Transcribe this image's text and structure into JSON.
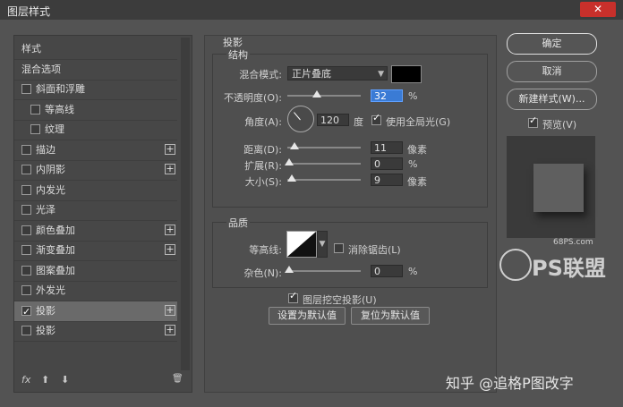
{
  "window": {
    "title": "图层样式",
    "close_label": "✕"
  },
  "left_panel": {
    "items": [
      {
        "label": "样式",
        "checkbox": false,
        "checked": false,
        "plus": false,
        "indent": 0
      },
      {
        "label": "混合选项",
        "checkbox": false,
        "checked": false,
        "plus": false,
        "indent": 0
      },
      {
        "label": "斜面和浮雕",
        "checkbox": true,
        "checked": false,
        "plus": false,
        "indent": 0
      },
      {
        "label": "等高线",
        "checkbox": true,
        "checked": false,
        "plus": false,
        "indent": 1
      },
      {
        "label": "纹理",
        "checkbox": true,
        "checked": false,
        "plus": false,
        "indent": 1
      },
      {
        "label": "描边",
        "checkbox": true,
        "checked": false,
        "plus": true,
        "indent": 0
      },
      {
        "label": "内阴影",
        "checkbox": true,
        "checked": false,
        "plus": true,
        "indent": 0
      },
      {
        "label": "内发光",
        "checkbox": true,
        "checked": false,
        "plus": false,
        "indent": 0
      },
      {
        "label": "光泽",
        "checkbox": true,
        "checked": false,
        "plus": false,
        "indent": 0
      },
      {
        "label": "颜色叠加",
        "checkbox": true,
        "checked": false,
        "plus": true,
        "indent": 0
      },
      {
        "label": "渐变叠加",
        "checkbox": true,
        "checked": false,
        "plus": true,
        "indent": 0
      },
      {
        "label": "图案叠加",
        "checkbox": true,
        "checked": false,
        "plus": false,
        "indent": 0
      },
      {
        "label": "外发光",
        "checkbox": true,
        "checked": false,
        "plus": false,
        "indent": 0
      },
      {
        "label": "投影",
        "checkbox": true,
        "checked": true,
        "plus": true,
        "indent": 0,
        "selected": true
      },
      {
        "label": "投影",
        "checkbox": true,
        "checked": false,
        "plus": true,
        "indent": 0
      }
    ],
    "footer": {
      "fx": "fx",
      "up": "⬆",
      "down": "⬇",
      "trash": "🗑"
    }
  },
  "drop_shadow": {
    "section_title": "投影",
    "structure_title": "结构",
    "blend_mode_label": "混合模式:",
    "blend_mode_value": "正片叠底",
    "shadow_color": "#000000",
    "opacity_label": "不透明度(O):",
    "opacity_value": "32",
    "opacity_unit": "%",
    "opacity_fraction": 0.32,
    "angle_label": "角度(A):",
    "angle_value": "120",
    "angle_unit": "度",
    "global_light_label": "使用全局光(G)",
    "global_light_checked": true,
    "distance_label": "距离(D):",
    "distance_value": "11",
    "distance_unit": "像素",
    "spread_label": "扩展(R):",
    "spread_value": "0",
    "spread_unit": "%",
    "size_label": "大小(S):",
    "size_value": "9",
    "size_unit": "像素",
    "quality_title": "品质",
    "contour_label": "等高线:",
    "antialias_label": "消除锯齿(L)",
    "antialias_checked": false,
    "noise_label": "杂色(N):",
    "noise_value": "0",
    "noise_unit": "%",
    "knockout_label": "图层挖空投影(U)",
    "knockout_checked": true,
    "make_default_label": "设置为默认值",
    "reset_default_label": "复位为默认值"
  },
  "right_panel": {
    "ok_label": "确定",
    "cancel_label": "取消",
    "new_style_label": "新建样式(W)...",
    "preview_label": "预览(V)",
    "preview_checked": true
  },
  "watermarks": {
    "site": "68PS.com",
    "logo_text": "PS联盟",
    "author": "知乎 @追格P图改字"
  }
}
